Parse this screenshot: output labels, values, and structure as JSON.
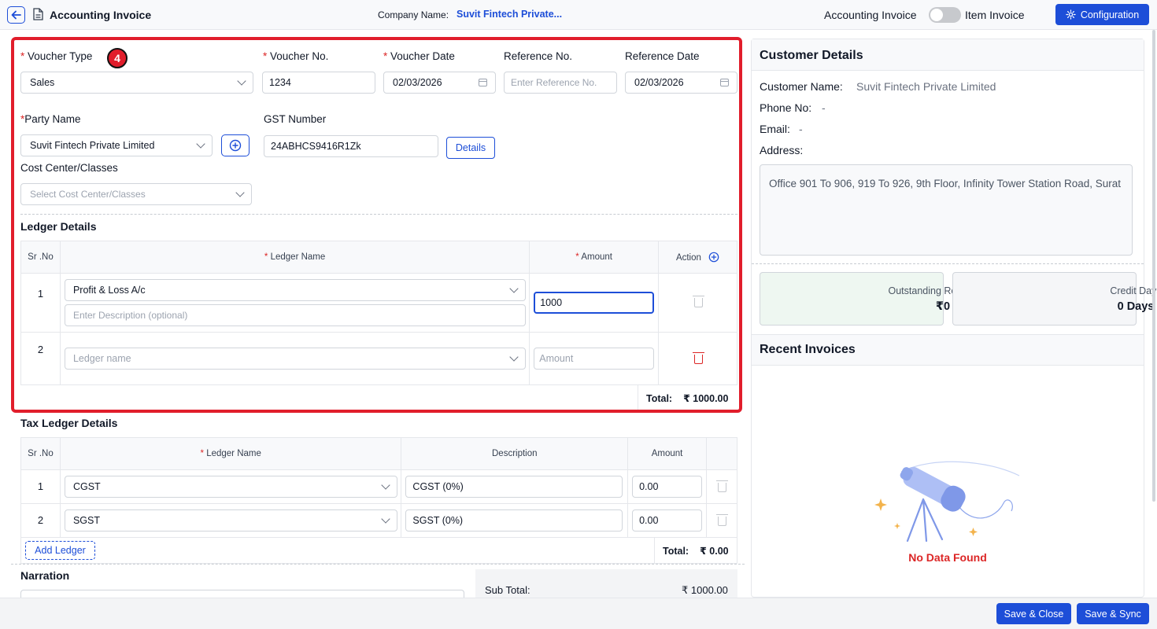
{
  "header": {
    "title": "Accounting Invoice",
    "company_label": "Company Name:",
    "company_value": "Suvit Fintech Private...",
    "toggle_left": "Accounting Invoice",
    "toggle_right": "Item Invoice",
    "config_label": "Configuration"
  },
  "step_badge": "4",
  "form": {
    "voucher_type_label": "Voucher Type",
    "voucher_type_value": "Sales",
    "voucher_no_label": "Voucher No.",
    "voucher_no_value": "1234",
    "voucher_date_label": "Voucher Date",
    "voucher_date_value": "02/03/2026",
    "reference_no_label": "Reference No.",
    "reference_no_placeholder": "Enter Reference No.",
    "reference_date_label": "Reference Date",
    "reference_date_value": "02/03/2026",
    "party_name_label": "Party Name",
    "party_name_value": "Suvit Fintech Private Limited",
    "gst_label": "GST Number",
    "gst_value": "24ABHCS9416R1Zk",
    "details_label": "Details",
    "cost_center_label": "Cost Center/Classes",
    "cost_center_placeholder": "Select Cost Center/Classes",
    "required_mark": "*"
  },
  "ledger": {
    "title": "Ledger Details",
    "col_srno": "Sr .No",
    "col_ledger": "Ledger Name",
    "col_amount": "Amount",
    "col_action": "Action",
    "rows": [
      {
        "sr": "1",
        "ledger": "Profit & Loss A/c",
        "description_placeholder": "Enter Description (optional)",
        "amount": "1000"
      },
      {
        "sr": "2",
        "ledger_placeholder": "Ledger name",
        "amount_placeholder": "Amount"
      }
    ],
    "total_label": "Total:",
    "total_value": "₹ 1000.00"
  },
  "tax_ledger": {
    "title": "Tax Ledger Details",
    "col_srno": "Sr .No",
    "col_ledger": "Ledger Name",
    "col_description": "Description",
    "col_amount": "Amount",
    "rows": [
      {
        "sr": "1",
        "ledger": "CGST",
        "description": "CGST (0%)",
        "amount": "0.00"
      },
      {
        "sr": "2",
        "ledger": "SGST",
        "description": "SGST (0%)",
        "amount": "0.00"
      }
    ],
    "add_ledger_label": "Add Ledger",
    "total_label": "Total:",
    "total_value": "₹ 0.00"
  },
  "narration": {
    "title": "Narration"
  },
  "subtotal": {
    "label": "Sub Total:",
    "value": "₹ 1000.00"
  },
  "customer": {
    "title": "Customer Details",
    "name_label": "Customer Name:",
    "name_value": "Suvit Fintech Private Limited",
    "phone_label": "Phone No:",
    "phone_value": "-",
    "email_label": "Email:",
    "email_value": "-",
    "address_label": "Address:",
    "address_value": "Office 901 To 906, 919 To 926, 9th Floor, Infinity Tower Station Road, Surat",
    "outstanding_label": "Outstanding Receivables",
    "outstanding_value": "₹0",
    "credit_label": "Credit Days",
    "credit_value": "0 Days",
    "recent_title": "Recent Invoices",
    "no_data": "No Data Found"
  },
  "footer": {
    "save_close": "Save & Close",
    "save_sync": "Save & Sync"
  },
  "colors": {
    "primary": "#1d4ed8",
    "highlight": "#e11d2b",
    "danger": "#dc2626"
  }
}
